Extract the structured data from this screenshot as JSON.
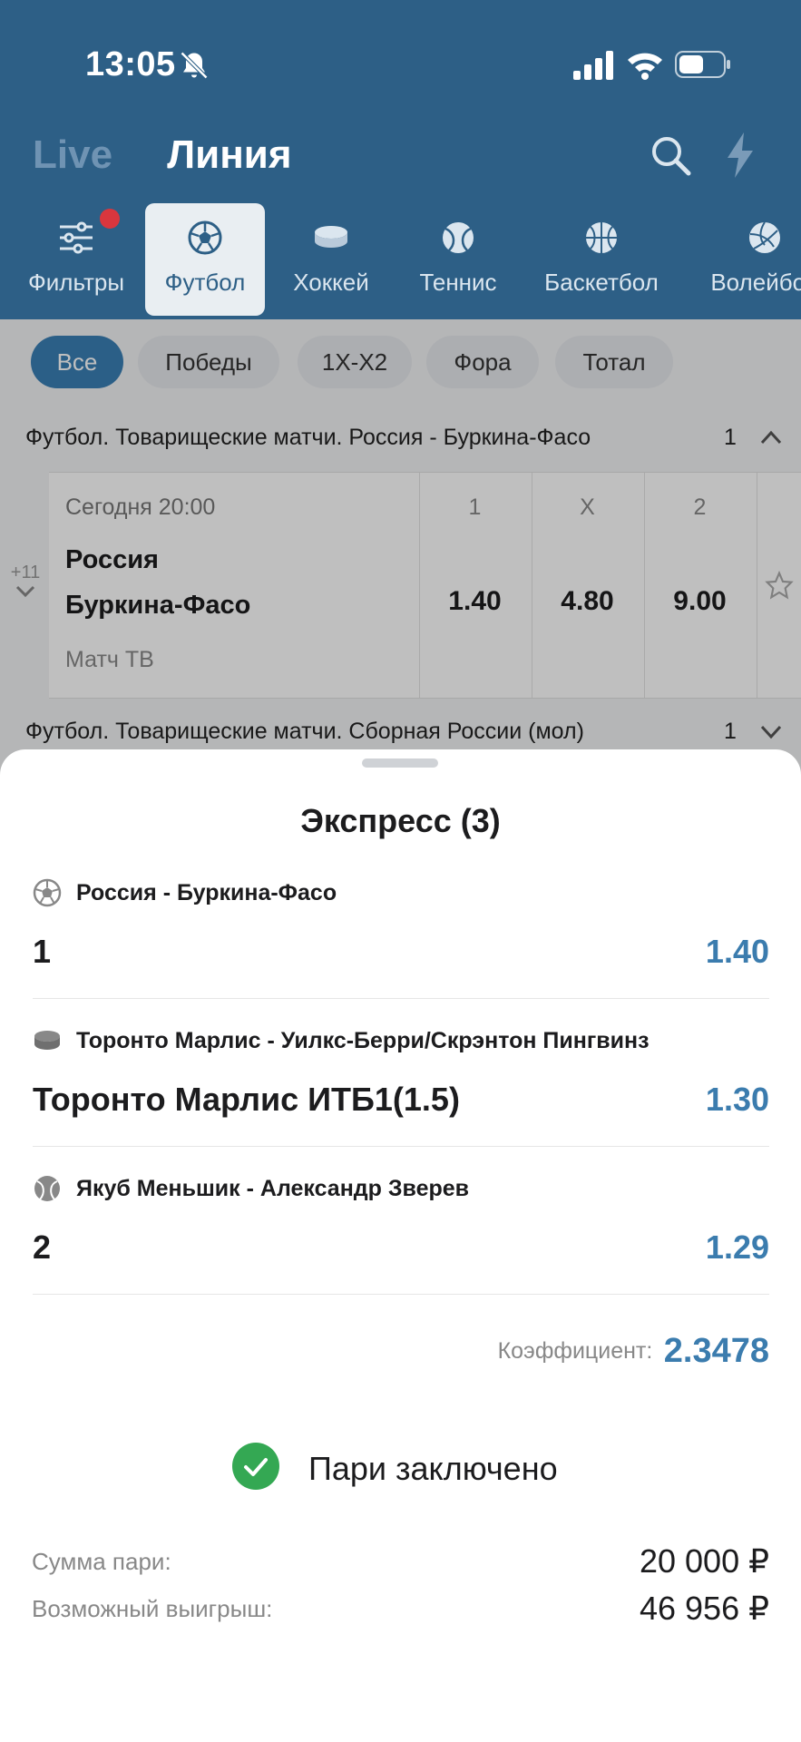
{
  "status_bar": {
    "time": "13:05"
  },
  "top_tabs": {
    "live": "Live",
    "line": "Линия"
  },
  "sports": [
    {
      "label": "Фильтры",
      "icon": "filters-icon"
    },
    {
      "label": "Футбол",
      "icon": "football-icon",
      "active": true
    },
    {
      "label": "Хоккей",
      "icon": "hockey-icon"
    },
    {
      "label": "Теннис",
      "icon": "tennis-icon"
    },
    {
      "label": "Баскетбол",
      "icon": "basketball-icon"
    },
    {
      "label": "Волейбол",
      "icon": "volleyball-icon"
    }
  ],
  "filter_chips": [
    "Все",
    "Победы",
    "1Х-Х2",
    "Фора",
    "Тотал"
  ],
  "leagues": [
    {
      "title": "Футбол. Товарищеские матчи. Россия - Буркина-Фасо",
      "count": "1"
    },
    {
      "title": "Футбол. Товарищеские матчи. Сборная России (мол)",
      "count": "1"
    }
  ],
  "match": {
    "date": "Сегодня 20:00",
    "team1": "Россия",
    "team2": "Буркина-Фасо",
    "tv": "Матч ТВ",
    "more": "+11",
    "odds_headers": [
      "1",
      "Х",
      "2"
    ],
    "odds": [
      "1.40",
      "4.80",
      "9.00"
    ]
  },
  "sheet": {
    "title": "Экспресс (3)",
    "legs": [
      {
        "event": "Россия - Буркина-Фасо",
        "selection": "1",
        "odd": "1.40",
        "icon": "football-icon"
      },
      {
        "event": "Торонто Марлис - Уилкс-Берри/Скрэнтон Пингвинз",
        "selection": "Торонто Марлис ИТБ1(1.5)",
        "odd": "1.30",
        "icon": "hockey-icon"
      },
      {
        "event": "Якуб Меньшик - Александр Зверев",
        "selection": "2",
        "odd": "1.29",
        "icon": "tennis-icon"
      }
    ],
    "coef_label": "Коэффициент:",
    "coef_value": "2.3478",
    "status": "Пари заключено",
    "sum_label": "Сумма пари:",
    "sum_value": "20 000 ₽",
    "win_label": "Возможный выигрыш:",
    "win_value": "46 956 ₽"
  },
  "colors": {
    "header": "#2d5f86",
    "accent": "#3b7cae",
    "success": "#34a853",
    "badge": "#d9363e"
  }
}
